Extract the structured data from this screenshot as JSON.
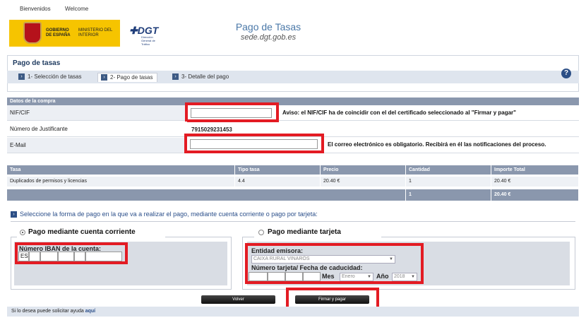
{
  "top_links": [
    "Bienvenidos",
    "Welcome"
  ],
  "header": {
    "gobierno": "GOBIERNO DE ESPAÑA",
    "ministerio": "MINISTERIO DEL INTERIOR",
    "dgt_logo": "DGT",
    "dgt_sub": "Dirección General de Tráfico",
    "title": "Pago de Tasas",
    "subtitle": "sede.dgt.gob.es"
  },
  "panel": {
    "heading": "Pago de tasas",
    "tabs": [
      {
        "num": "1",
        "label": "1- Selección de tasas"
      },
      {
        "num": "2",
        "label": "2- Pago de tasas"
      },
      {
        "num": "3",
        "label": "3- Detalle del pago"
      }
    ],
    "help": "?"
  },
  "purchase": {
    "header": "Datos de la compra",
    "nif_label": "NIF/CIF",
    "nif_value": "",
    "nif_notice": "Aviso: el NIF/CIF ha de coincidir con el del certificado seleccionado al \"Firmar y pagar\"",
    "justificante_label": "Número de Justificante",
    "justificante_value": "7915029231453",
    "email_label": "E-Mail",
    "email_value": "",
    "email_notice": "El correo electrónico es obligatorio. Recibirá en él las notificaciones del proceso."
  },
  "fees_table": {
    "headers": [
      "Tasa",
      "Tipo tasa",
      "Precio",
      "Cantidad",
      "Importe Total"
    ],
    "rows": [
      [
        "Duplicados de permisos y licencias",
        "4.4",
        "20.40 €",
        "1",
        "20.40 €"
      ]
    ],
    "total_quantity": "1",
    "total_amount": "20.40 €"
  },
  "payment": {
    "select_text": "Seleccione la forma de pago en la que va a realizar el pago, mediante cuenta corriente o pago por tarjeta:",
    "account": {
      "legend": "Pago mediante cuenta corriente",
      "iban_label": "Número IBAN de la cuenta:",
      "iban_prefix": "ES"
    },
    "card": {
      "legend": "Pago mediante tarjeta",
      "entity_label": "Entidad emisora:",
      "entity_value": "CAIXA RURAL VINARÒS",
      "card_label": "Número tarjeta/ Fecha de caducidad:",
      "month_label": "Mes",
      "month_value": "Enero",
      "year_label": "Año",
      "year_value": "2018"
    }
  },
  "buttons": {
    "back": "Volver",
    "sign_pay": "Firmar y pagar"
  },
  "footer": {
    "text": "Si lo desea puede solicitar ayuda",
    "link": "aquí"
  },
  "colors": {
    "highlight_red": "#e31b23",
    "header_bar": "#8a97ad",
    "link_blue": "#2b4f8a"
  }
}
